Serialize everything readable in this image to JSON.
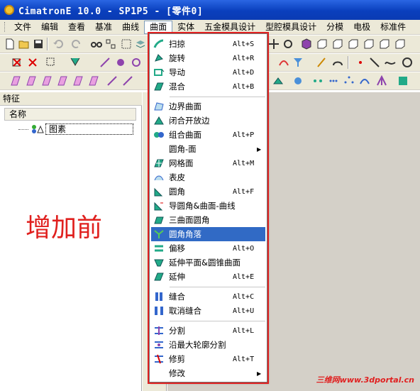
{
  "window": {
    "title": "CimatronE 10.0 - SP1P5 - [零件0]"
  },
  "menubar": {
    "items": [
      "文件",
      "编辑",
      "查看",
      "基准",
      "曲线",
      "曲面",
      "实体",
      "五金模具设计",
      "型腔模具设计",
      "分模",
      "电极",
      "标准件"
    ]
  },
  "panel": {
    "title": "特征",
    "column": "名称",
    "tree_item": "图素"
  },
  "annotation": "增加前",
  "watermark": "三维网www.3dportal.cn",
  "dropdown": {
    "items": [
      {
        "label": "扫掠",
        "shortcut": "Alt+S",
        "icon": "sweep-icon"
      },
      {
        "label": "旋转",
        "shortcut": "Alt+R",
        "icon": "revolve-icon"
      },
      {
        "label": "导动",
        "shortcut": "Alt+D",
        "icon": "drive-icon"
      },
      {
        "label": "混合",
        "shortcut": "Alt+B",
        "icon": "blend-icon"
      },
      {
        "label": "边界曲面",
        "shortcut": "",
        "icon": "boundary-surface-icon"
      },
      {
        "label": "闭合开放边",
        "shortcut": "",
        "icon": "close-open-edges-icon"
      },
      {
        "label": "组合曲面",
        "shortcut": "Alt+P",
        "icon": "composite-surface-icon"
      },
      {
        "label": "圆角-面",
        "shortcut": "",
        "icon": "",
        "submenu": true
      },
      {
        "label": "网格面",
        "shortcut": "Alt+M",
        "icon": "mesh-surface-icon"
      },
      {
        "label": "表皮",
        "shortcut": "",
        "icon": "skin-icon"
      },
      {
        "label": "圆角",
        "shortcut": "Alt+F",
        "icon": "fillet-icon"
      },
      {
        "label": "导圆角&曲面-曲线",
        "shortcut": "",
        "icon": "drive-fillet-icon"
      },
      {
        "label": "三曲面圆角",
        "shortcut": "",
        "icon": "three-surface-fillet-icon"
      },
      {
        "label": "圆角角落",
        "shortcut": "",
        "icon": "fillet-corner-icon",
        "highlighted": true
      },
      {
        "label": "偏移",
        "shortcut": "Alt+O",
        "icon": "offset-icon"
      },
      {
        "label": "延伸平面&圆锥曲面",
        "shortcut": "",
        "icon": "extend-plane-cone-icon"
      },
      {
        "label": "延伸",
        "shortcut": "Alt+E",
        "icon": "extend-icon"
      },
      {
        "label": "缝合",
        "shortcut": "Alt+C",
        "icon": "stitch-icon"
      },
      {
        "label": "取消缝合",
        "shortcut": "Alt+U",
        "icon": "unstitch-icon"
      },
      {
        "label": "分割",
        "shortcut": "Alt+L",
        "icon": "split-icon"
      },
      {
        "label": "沿最大轮廓分割",
        "shortcut": "",
        "icon": "split-max-contour-icon"
      },
      {
        "label": "修剪",
        "shortcut": "Alt+T",
        "icon": "trim-icon"
      },
      {
        "label": "修改",
        "shortcut": "",
        "icon": "",
        "submenu": true
      }
    ]
  },
  "colors": {
    "accent": "#316ac5",
    "title_blue": "#0a3fbd",
    "annotation_red": "#e02020"
  }
}
